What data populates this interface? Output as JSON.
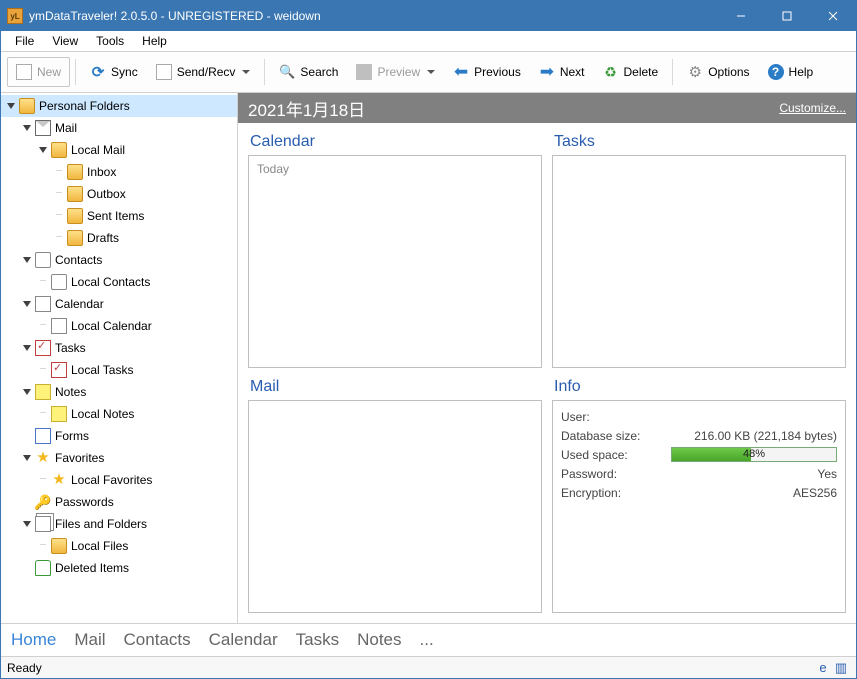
{
  "window": {
    "title": "ymDataTraveler! 2.0.5.0 - UNREGISTERED - weidown"
  },
  "menus": [
    "File",
    "View",
    "Tools",
    "Help"
  ],
  "toolbar": {
    "new": "New",
    "sync": "Sync",
    "sendrecv": "Send/Recv",
    "search": "Search",
    "preview": "Preview",
    "previous": "Previous",
    "next": "Next",
    "delete": "Delete",
    "options": "Options",
    "help": "Help"
  },
  "tree": {
    "root": "Personal Folders",
    "mail": "Mail",
    "local_mail": "Local Mail",
    "inbox": "Inbox",
    "outbox": "Outbox",
    "sent": "Sent Items",
    "drafts": "Drafts",
    "contacts": "Contacts",
    "local_contacts": "Local Contacts",
    "calendar": "Calendar",
    "local_calendar": "Local Calendar",
    "tasks": "Tasks",
    "local_tasks": "Local Tasks",
    "notes": "Notes",
    "local_notes": "Local Notes",
    "forms": "Forms",
    "favorites": "Favorites",
    "local_favorites": "Local Favorites",
    "passwords": "Passwords",
    "files": "Files and Folders",
    "local_files": "Local Files",
    "deleted": "Deleted Items"
  },
  "content": {
    "date_header": "2021年1月18日",
    "customize": "Customize...",
    "panels": {
      "calendar_title": "Calendar",
      "calendar_today": "Today",
      "tasks_title": "Tasks",
      "mail_title": "Mail",
      "info_title": "Info"
    },
    "info": {
      "user_label": "User:",
      "user_value": "",
      "dbsize_label": "Database size:",
      "dbsize_value": "216.00 KB (221,184 bytes)",
      "usedspace_label": "Used space:",
      "usedspace_pct": "48%",
      "password_label": "Password:",
      "password_value": "Yes",
      "encryption_label": "Encryption:",
      "encryption_value": "AES256"
    }
  },
  "bottom_tabs": [
    "Home",
    "Mail",
    "Contacts",
    "Calendar",
    "Tasks",
    "Notes",
    "..."
  ],
  "status": {
    "ready": "Ready"
  }
}
